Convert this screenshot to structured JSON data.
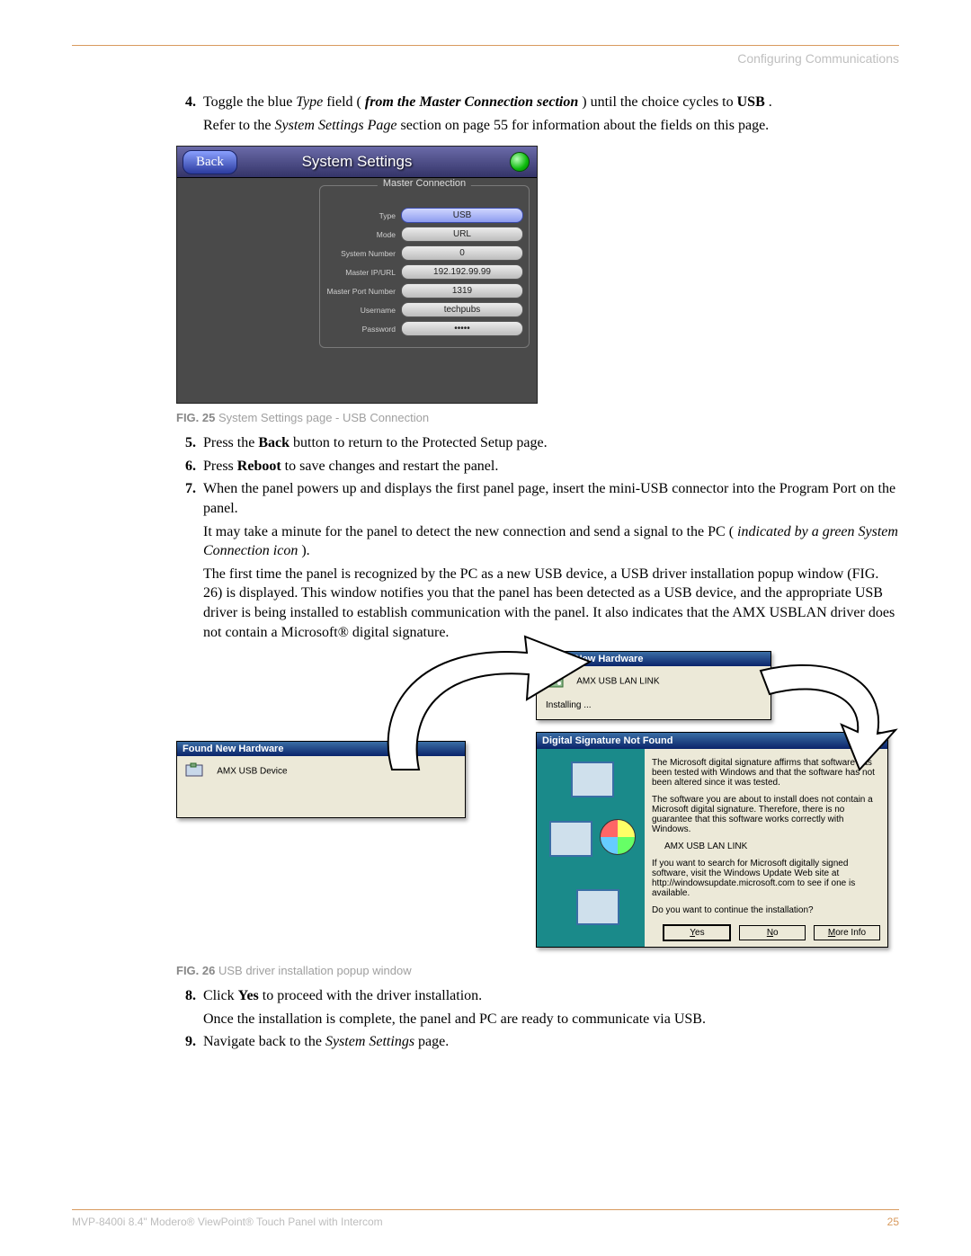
{
  "header": {
    "section": "Configuring Communications"
  },
  "steps": {
    "s4": {
      "num": "4.",
      "pre": "Toggle the blue ",
      "type_word": "Type",
      "mid1": " field (",
      "bold1": "from the Master Connection section",
      "mid2": ") until the choice cycles to ",
      "usb": "USB",
      "post": ".",
      "cont_pre": "Refer to the ",
      "cont_it": "System Settings Page",
      "cont_post": " section on page 55 for information about the fields on this page."
    },
    "s5": {
      "num": "5.",
      "pre": "Press the ",
      "bold": "Back",
      "post": " button to return to the Protected Setup page."
    },
    "s6": {
      "num": "6.",
      "pre": "Press ",
      "bold": "Reboot",
      "post": " to save changes and restart the panel."
    },
    "s7a": {
      "num": "7.",
      "text": "When the panel powers up and displays the first panel page, insert the mini-USB connector into the Program Port on the panel."
    },
    "s7b_pre": "It may take a minute for the panel to detect the new connection and send a signal to the PC (",
    "s7b_it": "indicated by a green System Connection icon",
    "s7b_post": ").",
    "s7c": "The first time the panel is recognized by the PC as a new USB device, a USB driver installation popup window (FIG. 26) is displayed. This window notifies you that the panel has been detected as a USB device, and the appropriate USB driver is being installed to establish communication with the panel. It also indicates that the AMX USBLAN driver does not contain a Microsoft® digital signature.",
    "s8": {
      "num": "8.",
      "pre": "Click ",
      "bold": "Yes",
      "post": " to proceed with the driver installation."
    },
    "s8b": "Once the installation is complete, the panel and PC are ready to communicate via USB.",
    "s9": {
      "num": "9.",
      "pre": "Navigate back to the ",
      "it": "System Settings",
      "post": " page."
    }
  },
  "fig25": {
    "caption_b": "FIG. 25",
    "caption": "  System Settings page - USB Connection",
    "back": "Back",
    "title": "System Settings",
    "legend": "Master Connection",
    "rows": [
      {
        "label": "Type",
        "value": "USB",
        "sel": true
      },
      {
        "label": "Mode",
        "value": "URL",
        "sel": false
      },
      {
        "label": "System Number",
        "value": "0",
        "sel": false
      },
      {
        "label": "Master IP/URL",
        "value": "192.192.99.99",
        "sel": false
      },
      {
        "label": "Master Port Number",
        "value": "1319",
        "sel": false
      },
      {
        "label": "Username",
        "value": "techpubs",
        "sel": false
      },
      {
        "label": "Password",
        "value": "•••••",
        "sel": false
      }
    ]
  },
  "fig26": {
    "caption_b": "FIG. 26",
    "caption": "  USB driver installation popup window",
    "win1_title": "Found New Hardware",
    "win1_line1": "AMX USB LAN LINK",
    "win1_line2": "Installing ...",
    "win2_title": "Found New Hardware",
    "win2_line1": "AMX USB Device",
    "win3_title": "Digital Signature Not Found",
    "win3_p1": "The Microsoft digital signature affirms that software has been tested with Windows and that the software has not been altered since it was tested.",
    "win3_p2": "The software you are about to install does not contain a Microsoft digital signature. Therefore, there is no guarantee that this software works correctly with Windows.",
    "win3_p3": "AMX USB LAN LINK",
    "win3_p4": "If you want to search for Microsoft digitally signed software, visit the Windows Update Web site at http://windowsupdate.microsoft.com to see if one is available.",
    "win3_p5": "Do you want to continue the installation?",
    "btn_yes": "Yes",
    "btn_no": "No",
    "btn_more": "More Info"
  },
  "footer": {
    "left": "MVP-8400i 8.4\" Modero® ViewPoint® Touch Panel with Intercom",
    "page": "25"
  }
}
